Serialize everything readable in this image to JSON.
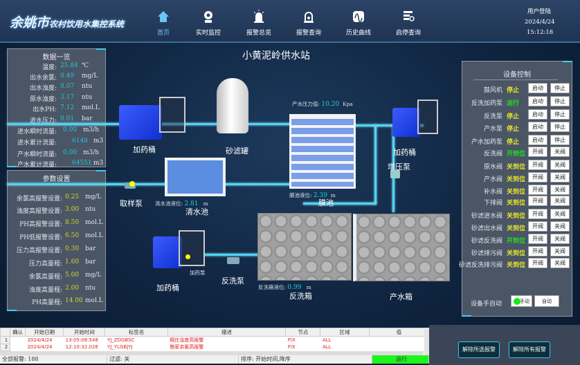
{
  "header": {
    "title_big": "余姚市",
    "title_small": "农村饮用水集控系统",
    "nav": [
      {
        "label": "首页",
        "icon": "home-icon",
        "active": true
      },
      {
        "label": "实时监控",
        "icon": "camera-icon"
      },
      {
        "label": "报警总览",
        "icon": "alarm-light-icon"
      },
      {
        "label": "报警查询",
        "icon": "alarm-search-icon"
      },
      {
        "label": "历史曲线",
        "icon": "curve-icon"
      },
      {
        "label": "启停查询",
        "icon": "list-search-icon"
      }
    ],
    "user_login": "用户登陆",
    "date": "2024/4/24",
    "time": "15:12:18"
  },
  "data_panel": {
    "title": "数据一览",
    "rows": [
      {
        "label": "温度:",
        "value": "25.84",
        "unit": "℃"
      },
      {
        "label": "出水余氯:",
        "value": "0.49",
        "unit": "mg/L"
      },
      {
        "label": "出水浊度:",
        "value": "0.07",
        "unit": "ntu"
      },
      {
        "label": "原水浊度:",
        "value": "3.17",
        "unit": "ntu"
      },
      {
        "label": "出水PH:",
        "value": "7.12",
        "unit": "mol.L"
      },
      {
        "label": "进水压力:",
        "value": "0.01",
        "unit": "bar"
      },
      {
        "label": "进水瞬时流量:",
        "value": "0.00",
        "unit": "m3/h"
      },
      {
        "label": "进水累计流量:",
        "value": "6148",
        "unit": "m3"
      },
      {
        "label": "产水瞬时流量:",
        "value": "0.00",
        "unit": "m3/h"
      },
      {
        "label": "产水累计流量:",
        "value": "64551",
        "unit": "m3"
      }
    ]
  },
  "param_panel": {
    "title": "参数设置",
    "rows": [
      {
        "label": "余氯高报警设置:",
        "value": "0.25",
        "unit": "mg/L"
      },
      {
        "label": "浊度高报警设置:",
        "value": "3.00",
        "unit": "ntu"
      },
      {
        "label": "PH高报警设置:",
        "value": "8.50",
        "unit": "mol.L"
      },
      {
        "label": "PH低报警设置:",
        "value": "6.50",
        "unit": "mol.L"
      },
      {
        "label": "压力高报警设置:",
        "value": "0.30",
        "unit": "bar"
      },
      {
        "label": "压力高量程:",
        "value": "1.60",
        "unit": "bar"
      },
      {
        "label": "余氯高量程:",
        "value": "5.00",
        "unit": "mg/L"
      },
      {
        "label": "浊度高量程:",
        "value": "2.00",
        "unit": "ntu"
      },
      {
        "label": "PH高量程:",
        "value": "14.00",
        "unit": "mol.L"
      }
    ]
  },
  "station": {
    "title": "小黄泥岭供水站",
    "labels": {
      "dosing1": "加药桶",
      "sand_filter": "砂滤罐",
      "dosing2": "加药桶",
      "booster": "增压泵",
      "sample_pump": "取样泵",
      "clear_pool": "清水池",
      "membrane": "膜池",
      "dosing3": "加药桶",
      "dosing_pump": "加药泵",
      "backwash_pump": "反洗泵",
      "backwash_tank": "反洗箱",
      "product_tank": "产水箱"
    },
    "readings": {
      "pressure_label": "产水压力值:",
      "pressure_value": "10.20",
      "pressure_unit": "Kpa",
      "clear_label": "清水池液位:",
      "clear_value": "2.81",
      "clear_unit": "m",
      "membrane_label": "膜池液位:",
      "membrane_value": "2.39",
      "membrane_unit": "m",
      "backwash_label": "反洗箱液位:",
      "backwash_value": "0.99",
      "backwash_unit": "m"
    }
  },
  "control": {
    "title": "设备控制",
    "colors": {
      "stop": "#e6e62a",
      "run": "#22dd22"
    },
    "rows": [
      {
        "name": "鼓风机",
        "status": "停止",
        "state": "stop",
        "b1": "启动",
        "b2": "停止"
      },
      {
        "name": "反洗加药泵",
        "status": "运行",
        "state": "run",
        "b1": "启动",
        "b2": "停止"
      },
      {
        "name": "反洗泵",
        "status": "停止",
        "state": "stop",
        "b1": "启动",
        "b2": "停止"
      },
      {
        "name": "产水泵",
        "status": "停止",
        "state": "stop",
        "b1": "启动",
        "b2": "停止"
      },
      {
        "name": "产水加药泵",
        "status": "停止",
        "state": "stop",
        "b1": "启动",
        "b2": "停止"
      },
      {
        "name": "反洗阀",
        "status": "开到位",
        "state": "run",
        "b1": "开阀",
        "b2": "关阀"
      },
      {
        "name": "原水阀",
        "status": "关到位",
        "state": "stop",
        "b1": "开阀",
        "b2": "关阀"
      },
      {
        "name": "产水阀",
        "status": "关到位",
        "state": "stop",
        "b1": "开阀",
        "b2": "关阀"
      },
      {
        "name": "补水阀",
        "status": "关到位",
        "state": "stop",
        "b1": "开阀",
        "b2": "关阀"
      },
      {
        "name": "下排阀",
        "status": "关到位",
        "state": "stop",
        "b1": "开阀",
        "b2": "关阀"
      },
      {
        "name": "砂滤进水阀",
        "status": "关到位",
        "state": "stop",
        "b1": "开阀",
        "b2": "关阀"
      },
      {
        "name": "砂滤出水阀",
        "status": "关到位",
        "state": "stop",
        "b1": "开阀",
        "b2": "关阀"
      },
      {
        "name": "砂滤反洗阀",
        "status": "开到位",
        "state": "run",
        "b1": "开阀",
        "b2": "关阀"
      },
      {
        "name": "砂滤排污阀",
        "status": "关到位",
        "state": "stop",
        "b1": "开阀",
        "b2": "关阀"
      },
      {
        "name": "砂滤反洗排污阀",
        "status": "关到位",
        "state": "stop",
        "b1": "开阀",
        "b2": "关阀"
      }
    ],
    "mode_label": "设备手自动",
    "manual": "手动",
    "auto": "自动"
  },
  "alarms": {
    "columns": [
      "确认",
      "开始日期",
      "开始时间",
      "标签名",
      "描述",
      "节点",
      "区域",
      "值"
    ],
    "rows": [
      {
        "idx": "1",
        "date": "2024/4/24",
        "time": "13:05:08.548",
        "tag": "YJ_ZDGBSC",
        "desc": "桐庄浊度高报警",
        "node": "FIX",
        "area": "ALL",
        "value": ""
      },
      {
        "idx": "2",
        "date": "2024/4/24",
        "time": "12:10:32.026",
        "tag": "YJ_YLGBJYJ",
        "desc": "鲍家余氯高报警",
        "node": "FIX",
        "area": "ALL",
        "value": ""
      }
    ],
    "total": "全部报警: 188",
    "filter": "过滤: 关",
    "sort": "排序: 开始时间,降序",
    "state": "运行",
    "ack_selected": "解除所选报警",
    "ack_all": "解除所有报警"
  }
}
